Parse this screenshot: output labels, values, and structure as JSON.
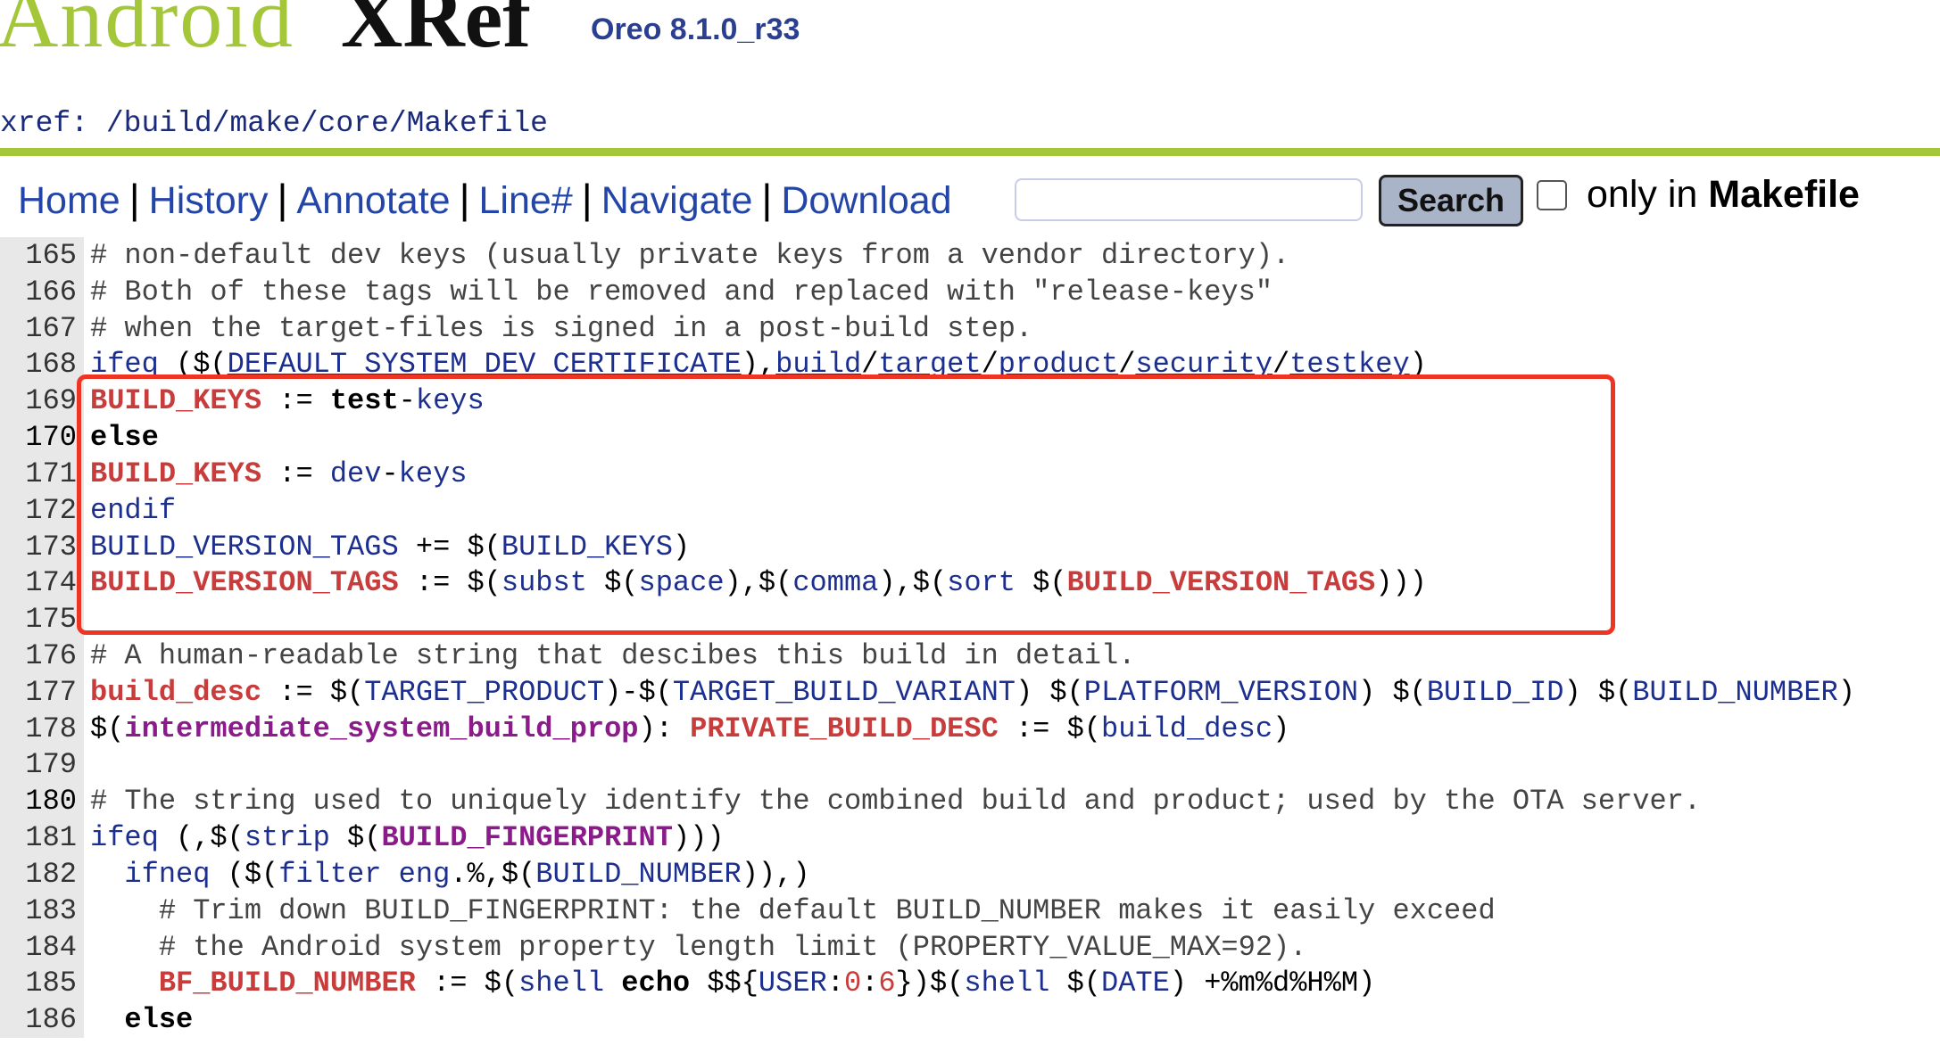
{
  "header": {
    "logo_part1": "Android",
    "logo_part2": "XRef",
    "version": "Oreo 8.1.0_r33",
    "breadcrumb": {
      "prefix": "xref",
      "colon": ":",
      "path": [
        {
          "sep": "/",
          "name": "build"
        },
        {
          "sep": "/",
          "name": "make"
        },
        {
          "sep": "/",
          "name": "core"
        },
        {
          "sep": "/",
          "name": "Makefile"
        }
      ]
    }
  },
  "toolbar": {
    "links": [
      "Home",
      "History",
      "Annotate",
      "Line#",
      "Navigate",
      "Download"
    ],
    "separator": "|",
    "search_placeholder": "",
    "search_button": "Search",
    "only_in_prefix": "only in",
    "only_in_file": "Makefile",
    "only_in_checked": false
  },
  "colors": {
    "brand_green": "#a4c639",
    "link_blue": "#2345a8",
    "variable_red": "#c83c3c",
    "function_purple": "#8b1a8b",
    "highlight_box": "#ee3524"
  },
  "code": {
    "lines": [
      {
        "n": "165",
        "hl": false,
        "tokens": [
          [
            "c",
            "# non-default dev keys (usually private keys from a vendor directory)."
          ]
        ]
      },
      {
        "n": "166",
        "hl": false,
        "tokens": [
          [
            "c",
            "# Both of these tags will be removed and replaced with \"release-keys\""
          ]
        ]
      },
      {
        "n": "167",
        "hl": false,
        "tokens": [
          [
            "c",
            "# when the target-files is signed in a post-build step."
          ]
        ]
      },
      {
        "n": "168",
        "hl": false,
        "tokens": [
          [
            "k",
            "ifeq"
          ],
          [
            "n",
            " ($("
          ],
          [
            "u",
            "DEFAULT_SYSTEM_DEV_CERTIFICATE"
          ],
          [
            "n",
            "),"
          ],
          [
            "u",
            "build"
          ],
          [
            "n",
            "/"
          ],
          [
            "u",
            "target"
          ],
          [
            "n",
            "/"
          ],
          [
            "u",
            "product"
          ],
          [
            "n",
            "/"
          ],
          [
            "u",
            "security"
          ],
          [
            "n",
            "/"
          ],
          [
            "u",
            "testkey"
          ],
          [
            "n",
            ")"
          ]
        ]
      },
      {
        "n": "169",
        "hl": false,
        "tokens": [
          [
            "v",
            "BUILD_KEYS"
          ],
          [
            "n",
            " := "
          ],
          [
            "b",
            "test"
          ],
          [
            "n",
            "-"
          ],
          [
            "k",
            "keys"
          ]
        ]
      },
      {
        "n": "170",
        "hl": true,
        "tokens": [
          [
            "b",
            "else"
          ]
        ]
      },
      {
        "n": "171",
        "hl": false,
        "tokens": [
          [
            "v",
            "BUILD_KEYS"
          ],
          [
            "n",
            " := "
          ],
          [
            "k",
            "dev"
          ],
          [
            "n",
            "-"
          ],
          [
            "k",
            "keys"
          ]
        ]
      },
      {
        "n": "172",
        "hl": false,
        "tokens": [
          [
            "k",
            "endif"
          ]
        ]
      },
      {
        "n": "173",
        "hl": false,
        "tokens": [
          [
            "k",
            "BUILD_VERSION_TAGS"
          ],
          [
            "n",
            " += $("
          ],
          [
            "k",
            "BUILD_KEYS"
          ],
          [
            "n",
            ")"
          ]
        ]
      },
      {
        "n": "174",
        "hl": false,
        "tokens": [
          [
            "v",
            "BUILD_VERSION_TAGS"
          ],
          [
            "n",
            " := $("
          ],
          [
            "k",
            "subst"
          ],
          [
            "n",
            " $("
          ],
          [
            "k",
            "space"
          ],
          [
            "n",
            "),$("
          ],
          [
            "k",
            "comma"
          ],
          [
            "n",
            "),$("
          ],
          [
            "k",
            "sort"
          ],
          [
            "n",
            " $("
          ],
          [
            "v",
            "BUILD_VERSION_TAGS"
          ],
          [
            "n",
            ")))"
          ]
        ]
      },
      {
        "n": "175",
        "hl": false,
        "tokens": []
      },
      {
        "n": "176",
        "hl": false,
        "tokens": [
          [
            "c",
            "# A human-readable string that descibes this build in detail."
          ]
        ]
      },
      {
        "n": "177",
        "hl": false,
        "tokens": [
          [
            "v",
            "build_desc"
          ],
          [
            "n",
            " := $("
          ],
          [
            "k",
            "TARGET_PRODUCT"
          ],
          [
            "n",
            ")-$("
          ],
          [
            "k",
            "TARGET_BUILD_VARIANT"
          ],
          [
            "n",
            ") $("
          ],
          [
            "k",
            "PLATFORM_VERSION"
          ],
          [
            "n",
            ") $("
          ],
          [
            "k",
            "BUILD_ID"
          ],
          [
            "n",
            ") $("
          ],
          [
            "k",
            "BUILD_NUMBER"
          ],
          [
            "n",
            ")"
          ]
        ]
      },
      {
        "n": "178",
        "hl": false,
        "tokens": [
          [
            "n",
            "$("
          ],
          [
            "p",
            "intermediate_system_build_prop"
          ],
          [
            "n",
            "): "
          ],
          [
            "v",
            "PRIVATE_BUILD_DESC"
          ],
          [
            "n",
            " := $("
          ],
          [
            "k",
            "build_desc"
          ],
          [
            "n",
            ")"
          ]
        ]
      },
      {
        "n": "179",
        "hl": false,
        "tokens": []
      },
      {
        "n": "180",
        "hl": true,
        "tokens": [
          [
            "c",
            "# The string used to uniquely identify the combined build and product; used by the OTA server."
          ]
        ]
      },
      {
        "n": "181",
        "hl": false,
        "tokens": [
          [
            "k",
            "ifeq"
          ],
          [
            "n",
            " (,$("
          ],
          [
            "k",
            "strip"
          ],
          [
            "n",
            " $("
          ],
          [
            "p",
            "BUILD_FINGERPRINT"
          ],
          [
            "n",
            ")))"
          ]
        ]
      },
      {
        "n": "182",
        "hl": false,
        "tokens": [
          [
            "n",
            "  "
          ],
          [
            "k",
            "ifneq"
          ],
          [
            "n",
            " ($("
          ],
          [
            "k",
            "filter"
          ],
          [
            "n",
            " "
          ],
          [
            "k",
            "eng"
          ],
          [
            "n",
            ".%,$("
          ],
          [
            "k",
            "BUILD_NUMBER"
          ],
          [
            "n",
            ")),)"
          ]
        ]
      },
      {
        "n": "183",
        "hl": false,
        "tokens": [
          [
            "c",
            "    # Trim down BUILD_FINGERPRINT: the default BUILD_NUMBER makes it easily exceed"
          ]
        ]
      },
      {
        "n": "184",
        "hl": false,
        "tokens": [
          [
            "c",
            "    # the Android system property length limit (PROPERTY_VALUE_MAX=92)."
          ]
        ]
      },
      {
        "n": "185",
        "hl": false,
        "tokens": [
          [
            "n",
            "    "
          ],
          [
            "v",
            "BF_BUILD_NUMBER"
          ],
          [
            "n",
            " := $("
          ],
          [
            "k",
            "shell"
          ],
          [
            "n",
            " "
          ],
          [
            "b",
            "echo"
          ],
          [
            "n",
            " $${"
          ],
          [
            "k",
            "USER"
          ],
          [
            "n",
            ":"
          ],
          [
            "r",
            "0"
          ],
          [
            "n",
            ":"
          ],
          [
            "r",
            "6"
          ],
          [
            "n",
            "})$("
          ],
          [
            "k",
            "shell"
          ],
          [
            "n",
            " $("
          ],
          [
            "k",
            "DATE"
          ],
          [
            "n",
            ") +%m%d%H%M)"
          ]
        ]
      },
      {
        "n": "186",
        "hl": false,
        "tokens": [
          [
            "n",
            "  "
          ],
          [
            "b",
            "else"
          ]
        ]
      }
    ]
  }
}
